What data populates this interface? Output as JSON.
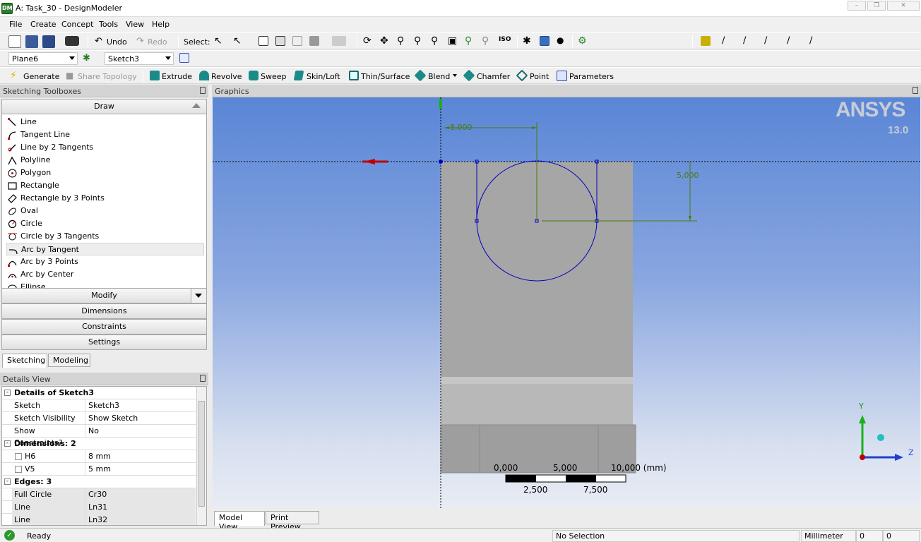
{
  "window": {
    "app_icon": "DM",
    "title": "A: Task_30 - DesignModeler"
  },
  "menu": [
    "File",
    "Create",
    "Concept",
    "Tools",
    "View",
    "Help"
  ],
  "toolbar1": {
    "undo": "Undo",
    "redo": "Redo",
    "select_label": "Select:"
  },
  "toolbar2": {
    "plane": "Plane6",
    "sketch": "Sketch3"
  },
  "toolbar3": {
    "generate": "Generate",
    "share_topology": "Share Topology",
    "extrude": "Extrude",
    "revolve": "Revolve",
    "sweep": "Sweep",
    "skin_loft": "Skin/Loft",
    "thin_surface": "Thin/Surface",
    "blend": "Blend",
    "chamfer": "Chamfer",
    "point": "Point",
    "parameters": "Parameters"
  },
  "toolboxes": {
    "title": "Sketching Toolboxes",
    "draw_header": "Draw",
    "tools": [
      "Line",
      "Tangent Line",
      "Line by 2 Tangents",
      "Polyline",
      "Polygon",
      "Rectangle",
      "Rectangle by 3 Points",
      "Oval",
      "Circle",
      "Circle by 3 Tangents",
      "Arc by Tangent",
      "Arc by 3 Points",
      "Arc by Center",
      "Ellipse"
    ],
    "groups": [
      "Modify",
      "Dimensions",
      "Constraints",
      "Settings"
    ],
    "tabs": [
      "Sketching",
      "Modeling"
    ]
  },
  "details": {
    "title": "Details View",
    "header": "Details of Sketch3",
    "rows": [
      {
        "k": "Sketch",
        "v": "Sketch3"
      },
      {
        "k": "Sketch Visibility",
        "v": "Show Sketch"
      },
      {
        "k": "Show Constraints?",
        "v": "No"
      }
    ],
    "dim_header": "Dimensions: 2",
    "dims": [
      {
        "k": "H6",
        "v": "8 mm"
      },
      {
        "k": "V5",
        "v": "5 mm"
      }
    ],
    "edge_header": "Edges: 3",
    "edges": [
      {
        "k": "Full Circle",
        "v": "Cr30"
      },
      {
        "k": "Line",
        "v": "Ln31"
      },
      {
        "k": "Line",
        "v": "Ln32"
      }
    ]
  },
  "graphics": {
    "title": "Graphics",
    "logo": "ANSYS",
    "version": "13.0",
    "dim_h": "8,000",
    "dim_v": "5,000",
    "scale_top": [
      "0,000",
      "5,000",
      "10,000 (mm)"
    ],
    "scale_bottom": [
      "2,500",
      "7,500"
    ],
    "axis_y": "Y",
    "axis_z": "Z",
    "tabs": [
      "Model View",
      "Print Preview"
    ]
  },
  "status": {
    "text": "Ready",
    "selection": "No Selection",
    "units": "Millimeter",
    "v1": "0",
    "v2": "0"
  },
  "colors": {
    "sketch_blue": "#0000c0",
    "dimension_green": "#4a7a10",
    "viewport_top": "#5a86d6",
    "part_gray": "#a6a6a6"
  }
}
